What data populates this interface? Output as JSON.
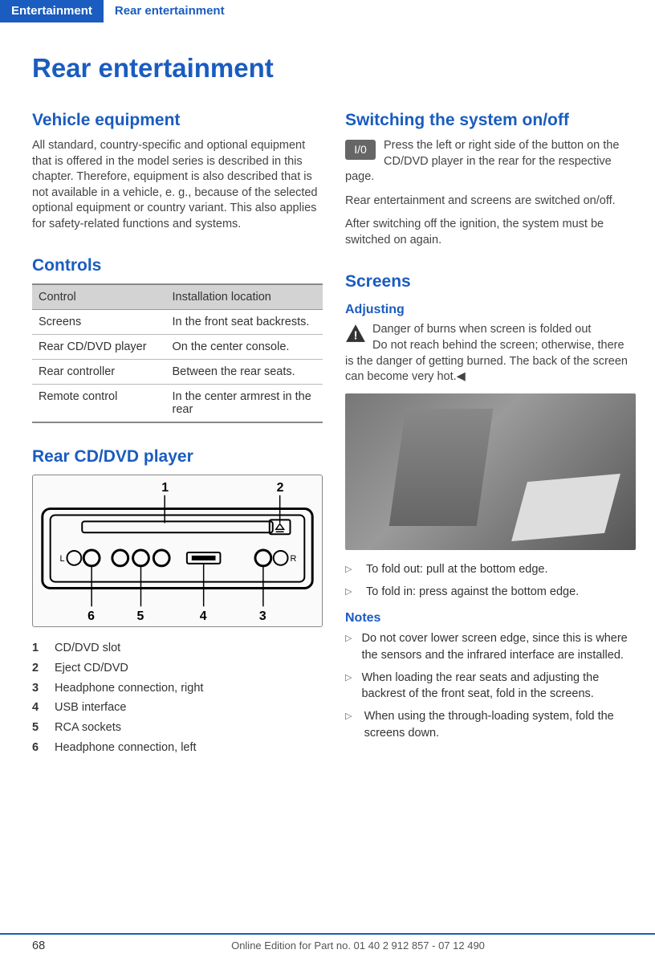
{
  "tabs": {
    "active": "Entertainment",
    "secondary": "Rear entertainment"
  },
  "title": "Rear entertainment",
  "left": {
    "vehicle_equipment": {
      "heading": "Vehicle equipment",
      "body": "All standard, country-specific and optional equipment that is offered in the model series is described in this chapter. Therefore, equipment is also described that is not available in a vehicle, e. g., because of the selected optional equipment or country variant. This also applies for safety-related functions and systems."
    },
    "controls": {
      "heading": "Controls",
      "th1": "Control",
      "th2": "Installation location",
      "rows": [
        {
          "c": "Screens",
          "l": "In the front seat backrests."
        },
        {
          "c": "Rear CD/DVD player",
          "l": "On the center console."
        },
        {
          "c": "Rear controller",
          "l": "Between the rear seats."
        },
        {
          "c": "Remote control",
          "l": "In the center armrest in the rear"
        }
      ]
    },
    "player": {
      "heading": "Rear CD/DVD player",
      "labels": {
        "n1": "1",
        "n2": "2",
        "n3": "3",
        "n4": "4",
        "n5": "5",
        "n6": "6"
      },
      "legend": [
        {
          "n": "1",
          "t": "CD/DVD slot"
        },
        {
          "n": "2",
          "t": "Eject CD/DVD"
        },
        {
          "n": "3",
          "t": "Headphone connection, right"
        },
        {
          "n": "4",
          "t": "USB interface"
        },
        {
          "n": "5",
          "t": "RCA sockets"
        },
        {
          "n": "6",
          "t": "Headphone connection, left"
        }
      ]
    }
  },
  "right": {
    "switching": {
      "heading": "Switching the system on/off",
      "badge": "I/0",
      "p1": "Press the left or right side of the button on the CD/DVD player in the rear for the respective page.",
      "p2": "Rear entertainment and screens are switched on/off.",
      "p3": "After switching off the ignition, the system must be switched on again."
    },
    "screens": {
      "heading": "Screens",
      "adjusting": {
        "heading": "Adjusting",
        "warn": "Danger of burns when screen is folded out",
        "warn_body": "Do not reach behind the screen; otherwise, there is the danger of getting burned. The back of the screen can become very hot.◀",
        "fold": [
          "To fold out: pull at the bottom edge.",
          "To fold in: press against the bottom edge."
        ]
      },
      "notes": {
        "heading": "Notes",
        "items": [
          "Do not cover lower screen edge, since this is where the sensors and the infrared interface are installed.",
          "When loading the rear seats and adjusting the backrest of the front seat, fold in the screens.",
          "When using the through-loading system, fold the screens down."
        ]
      }
    }
  },
  "footer": {
    "page": "68",
    "line": "Online Edition for Part no. 01 40 2 912 857 - 07 12 490"
  }
}
